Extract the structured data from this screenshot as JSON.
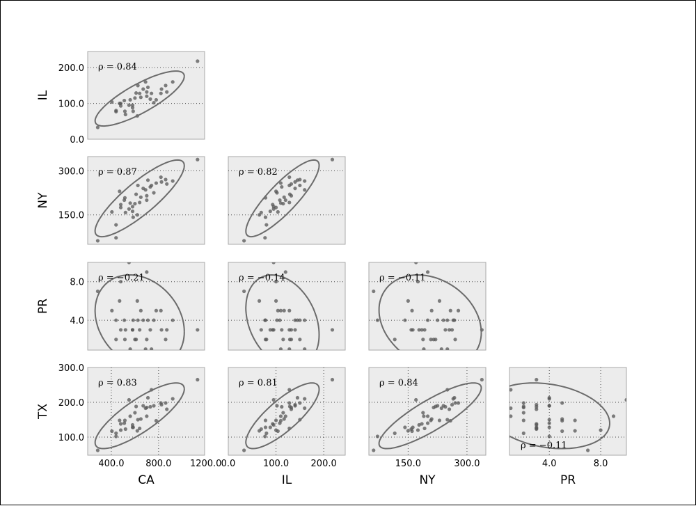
{
  "chart_data": {
    "type": "scatter",
    "subtype": "scatter-matrix (lower triangle) with covariance ellipses",
    "variables": [
      "CA",
      "IL",
      "NY",
      "PR",
      "TX"
    ],
    "column_labels": [
      "CA",
      "IL",
      "NY",
      "PR"
    ],
    "row_labels": [
      "IL",
      "NY",
      "PR",
      "TX"
    ],
    "axis_ranges": {
      "CA": [
        200,
        1190
      ],
      "IL": [
        0,
        245
      ],
      "NY": [
        50,
        348
      ],
      "PR": [
        0.9,
        10
      ],
      "TX": [
        48,
        300
      ]
    },
    "ticks": {
      "x": {
        "CA": {
          "values": [
            400,
            800,
            1200
          ],
          "labels": [
            "400.0",
            "800.0",
            "1200.0"
          ]
        },
        "IL": {
          "values": [
            0,
            100,
            200
          ],
          "labels": [
            "0.0",
            "100.0",
            "200.0"
          ]
        },
        "NY": {
          "values": [
            150,
            300
          ],
          "labels": [
            "150.0",
            "300.0"
          ]
        },
        "PR": {
          "values": [
            4,
            8
          ],
          "labels": [
            "4.0",
            "8.0"
          ]
        }
      },
      "y": {
        "IL": {
          "values": [
            200,
            100,
            0
          ],
          "labels": [
            "200.0",
            "100.0",
            "0.0"
          ]
        },
        "NY": {
          "values": [
            300,
            150
          ],
          "labels": [
            "300.0",
            "150.0"
          ]
        },
        "PR": {
          "values": [
            8,
            4
          ],
          "labels": [
            "8.0",
            "4.0"
          ]
        },
        "TX": {
          "values": [
            300,
            200,
            100
          ],
          "labels": [
            "300.0",
            "200.0",
            "100.0"
          ]
        }
      }
    },
    "panels": [
      {
        "x": "CA",
        "y": "IL",
        "rho": "ρ = 0.84",
        "label_pos": "top-left"
      },
      {
        "x": "CA",
        "y": "NY",
        "rho": "ρ = 0.87",
        "label_pos": "top-left"
      },
      {
        "x": "IL",
        "y": "NY",
        "rho": "ρ = 0.82",
        "label_pos": "top-left"
      },
      {
        "x": "CA",
        "y": "PR",
        "rho": "ρ = −0.21",
        "label_pos": "top-left"
      },
      {
        "x": "IL",
        "y": "PR",
        "rho": "ρ = −0.14",
        "label_pos": "top-left"
      },
      {
        "x": "NY",
        "y": "PR",
        "rho": "ρ = −0.11",
        "label_pos": "top-left"
      },
      {
        "x": "CA",
        "y": "TX",
        "rho": "ρ = 0.83",
        "label_pos": "top-left"
      },
      {
        "x": "IL",
        "y": "TX",
        "rho": "ρ = 0.81",
        "label_pos": "top-left"
      },
      {
        "x": "NY",
        "y": "TX",
        "rho": "ρ = 0.84",
        "label_pos": "top-left"
      },
      {
        "x": "PR",
        "y": "TX",
        "rho": "ρ = −0.11",
        "label_pos": "bottom-left"
      }
    ],
    "points": [
      [
        285,
        33,
        62,
        7,
        62
      ],
      [
        1130,
        218,
        338,
        3,
        265
      ],
      [
        405,
        104,
        160,
        5,
        117
      ],
      [
        440,
        77,
        72,
        4,
        102
      ],
      [
        440,
        80,
        116,
        2,
        111
      ],
      [
        470,
        100,
        230,
        6,
        148
      ],
      [
        480,
        93,
        185,
        3,
        138
      ],
      [
        510,
        108,
        200,
        4,
        140
      ],
      [
        515,
        78,
        208,
        2,
        148
      ],
      [
        520,
        69,
        158,
        3,
        123
      ],
      [
        560,
        110,
        190,
        1,
        160
      ],
      [
        580,
        95,
        178,
        3,
        135
      ],
      [
        580,
        88,
        162,
        3,
        128
      ],
      [
        585,
        78,
        142,
        4,
        128
      ],
      [
        600,
        115,
        188,
        2,
        170
      ],
      [
        610,
        129,
        220,
        2,
        188
      ],
      [
        625,
        150,
        250,
        4,
        150
      ],
      [
        640,
        128,
        192,
        3,
        125
      ],
      [
        650,
        117,
        210,
        5,
        152
      ],
      [
        670,
        140,
        240,
        4,
        190
      ],
      [
        690,
        160,
        235,
        1,
        183
      ],
      [
        700,
        132,
        215,
        2,
        185
      ],
      [
        710,
        145,
        268,
        4,
        213
      ],
      [
        730,
        112,
        245,
        3,
        187
      ],
      [
        740,
        128,
        250,
        1,
        236
      ],
      [
        760,
        102,
        225,
        4,
        190
      ],
      [
        780,
        110,
        258,
        5,
        147
      ],
      [
        820,
        128,
        278,
        5,
        198
      ],
      [
        825,
        140,
        262,
        3,
        193
      ],
      [
        860,
        150,
        270,
        2,
        198
      ],
      [
        870,
        132,
        255,
        3,
        180
      ],
      [
        920,
        160,
        265,
        4,
        210
      ],
      [
        550,
        95,
        170,
        10,
        207
      ],
      [
        480,
        100,
        175,
        8,
        120
      ],
      [
        620,
        65,
        150,
        6,
        118
      ],
      [
        700,
        120,
        200,
        9,
        160
      ]
    ],
    "grid": "dotted at tick positions",
    "colors": {
      "panel_bg": "#ececec",
      "point": "#555555",
      "ellipse": "#6b6b6b",
      "panel_border": "#a8a8a8"
    }
  }
}
